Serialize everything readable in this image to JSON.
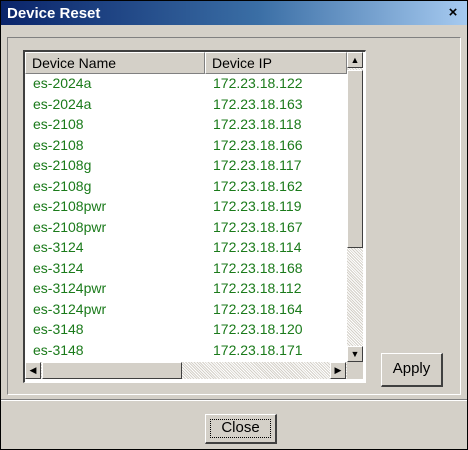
{
  "window": {
    "title": "Device Reset",
    "close_glyph": "×"
  },
  "table": {
    "columns": [
      "Device Name",
      "Device IP"
    ],
    "rows": [
      {
        "name": "es-2024a",
        "ip": "172.23.18.122"
      },
      {
        "name": "es-2024a",
        "ip": "172.23.18.163"
      },
      {
        "name": "es-2108",
        "ip": "172.23.18.118"
      },
      {
        "name": "es-2108",
        "ip": "172.23.18.166"
      },
      {
        "name": "es-2108g",
        "ip": "172.23.18.117"
      },
      {
        "name": "es-2108g",
        "ip": "172.23.18.162"
      },
      {
        "name": "es-2108pwr",
        "ip": "172.23.18.119"
      },
      {
        "name": "es-2108pwr",
        "ip": "172.23.18.167"
      },
      {
        "name": "es-3124",
        "ip": "172.23.18.114"
      },
      {
        "name": "es-3124",
        "ip": "172.23.18.168"
      },
      {
        "name": "es-3124pwr",
        "ip": "172.23.18.112"
      },
      {
        "name": "es-3124pwr",
        "ip": "172.23.18.164"
      },
      {
        "name": "es-3148",
        "ip": "172.23.18.120"
      },
      {
        "name": "es-3148",
        "ip": "172.23.18.171"
      }
    ],
    "row_text_color": "#1a7a1a"
  },
  "scrollbar": {
    "up_glyph": "▲",
    "down_glyph": "▼",
    "left_glyph": "◀",
    "right_glyph": "▶"
  },
  "buttons": {
    "apply_label": "Apply",
    "close_label": "Close"
  },
  "colors": {
    "title_bar": "#0a246a",
    "dialog_face": "#d4d0c8"
  }
}
